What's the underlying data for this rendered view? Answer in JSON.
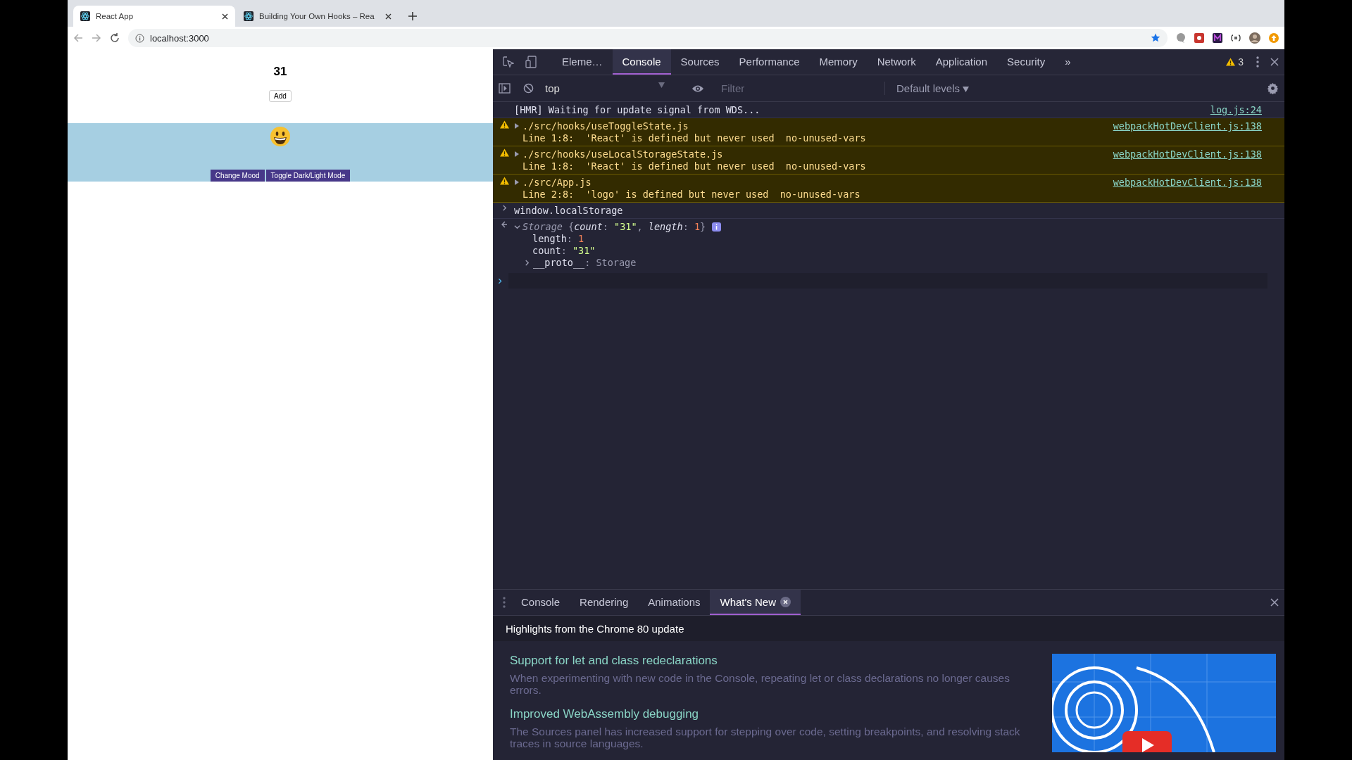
{
  "browser": {
    "tabs": [
      {
        "title": "React App",
        "selected": true
      },
      {
        "title": "Building Your Own Hooks – Rea",
        "selected": false
      }
    ],
    "address": "localhost:3000"
  },
  "page": {
    "count": "31",
    "add_button": "Add",
    "buttons": [
      "Change Mood",
      "Toggle Dark/Light Mode"
    ]
  },
  "devtools": {
    "tabs": [
      {
        "label": "Eleme…",
        "selected": false
      },
      {
        "label": "Console",
        "selected": true
      },
      {
        "label": "Sources",
        "selected": false
      },
      {
        "label": "Performance",
        "selected": false
      },
      {
        "label": "Memory",
        "selected": false
      },
      {
        "label": "Network",
        "selected": false
      },
      {
        "label": "Application",
        "selected": false
      },
      {
        "label": "Security",
        "selected": false
      }
    ],
    "more": "»",
    "warning_count": "3",
    "context": "top",
    "filter_placeholder": "Filter",
    "levels": "Default levels",
    "messages": [
      {
        "kind": "log",
        "text": "[HMR] Waiting for update signal from WDS...",
        "source": "log.js:24"
      },
      {
        "kind": "warning",
        "file": "./src/hooks/useToggleState.js",
        "detail": "Line 1:8:  'React' is defined but never used  no-unused-vars",
        "source": "webpackHotDevClient.js:138"
      },
      {
        "kind": "warning",
        "file": "./src/hooks/useLocalStorageState.js",
        "detail": "Line 1:8:  'React' is defined but never used  no-unused-vars",
        "source": "webpackHotDevClient.js:138"
      },
      {
        "kind": "warning",
        "file": "./src/App.js",
        "detail": "Line 2:8:  'logo' is defined but never used  no-unused-vars",
        "source": "webpackHotDevClient.js:138"
      },
      {
        "kind": "input",
        "text": "window.localStorage"
      },
      {
        "kind": "result",
        "expanded": true,
        "summary": [
          {
            "text": "Storage ",
            "kind": "type"
          },
          {
            "text": "{",
            "kind": "punct"
          },
          {
            "text": "count",
            "kind": "key"
          },
          {
            "text": ": ",
            "kind": "punct"
          },
          {
            "text": "\"31\"",
            "kind": "string"
          },
          {
            "text": ", ",
            "kind": "punct"
          },
          {
            "text": "length",
            "kind": "key"
          },
          {
            "text": ": ",
            "kind": "punct"
          },
          {
            "text": "1",
            "kind": "number"
          },
          {
            "text": "}",
            "kind": "punct"
          }
        ],
        "properties": [
          {
            "segments": [
              {
                "text": "length",
                "kind": "prop"
              },
              {
                "text": ": ",
                "kind": "punct"
              },
              {
                "text": "1",
                "kind": "number"
              }
            ]
          },
          {
            "segments": [
              {
                "text": "count",
                "kind": "prop"
              },
              {
                "text": ": ",
                "kind": "punct"
              },
              {
                "text": "\"31\"",
                "kind": "string"
              }
            ]
          }
        ],
        "proto": {
          "expanded": false,
          "segments": [
            {
              "text": "__proto__",
              "kind": "prop"
            },
            {
              "text": ": Storage",
              "kind": "punct"
            }
          ]
        }
      }
    ]
  },
  "drawer": {
    "tabs": [
      {
        "label": "Console",
        "selected": false,
        "closable": false
      },
      {
        "label": "Rendering",
        "selected": false,
        "closable": false
      },
      {
        "label": "Animations",
        "selected": false,
        "closable": false
      },
      {
        "label": "What's New",
        "selected": true,
        "closable": true
      }
    ],
    "heading": "Highlights from the Chrome 80 update",
    "items": [
      {
        "title": "Support for let and class redeclarations",
        "description": "When experimenting with new code in the Console, repeating let or class declarations no longer causes errors."
      },
      {
        "title": "Improved WebAssembly debugging",
        "description": "The Sources panel has increased support for stepping over code, setting breakpoints, and resolving stack traces in source languages."
      }
    ]
  }
}
